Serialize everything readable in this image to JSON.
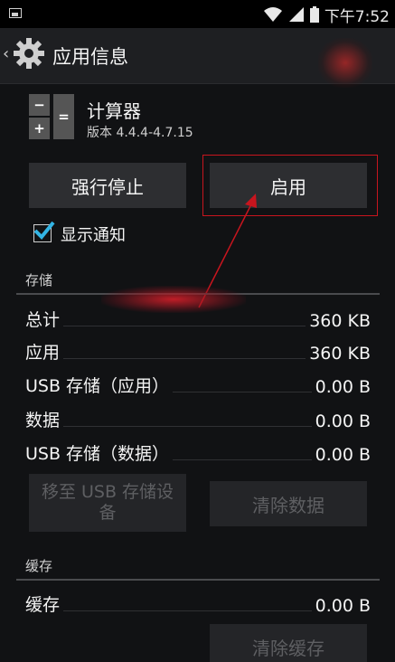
{
  "status_bar": {
    "time": "下午7:52"
  },
  "action_bar": {
    "title": "应用信息"
  },
  "app": {
    "name": "计算器",
    "version": "版本 4.4.4-4.7.15",
    "icon_keys": [
      "−",
      "=",
      "+",
      ""
    ]
  },
  "buttons": {
    "force_stop": "强行停止",
    "enable": "启用",
    "move_to_usb": "移至 USB 存储设备",
    "clear_data": "清除数据",
    "clear_cache": "清除缓存"
  },
  "show_notifications": {
    "label": "显示通知",
    "checked": true
  },
  "storage": {
    "header": "存储",
    "rows": [
      {
        "label": "总计",
        "value": "360 KB"
      },
      {
        "label": "应用",
        "value": "360 KB"
      },
      {
        "label": "USB 存储（应用）",
        "value": "0.00 B"
      },
      {
        "label": "数据",
        "value": "0.00 B"
      },
      {
        "label": "USB 存储（数据）",
        "value": "0.00 B"
      }
    ]
  },
  "cache": {
    "header": "缓存",
    "rows": [
      {
        "label": "缓存",
        "value": "0.00 B"
      }
    ]
  },
  "colors": {
    "accent_highlight": "#c8151e",
    "checkbox_check": "#33b5e5",
    "background": "#111214"
  }
}
